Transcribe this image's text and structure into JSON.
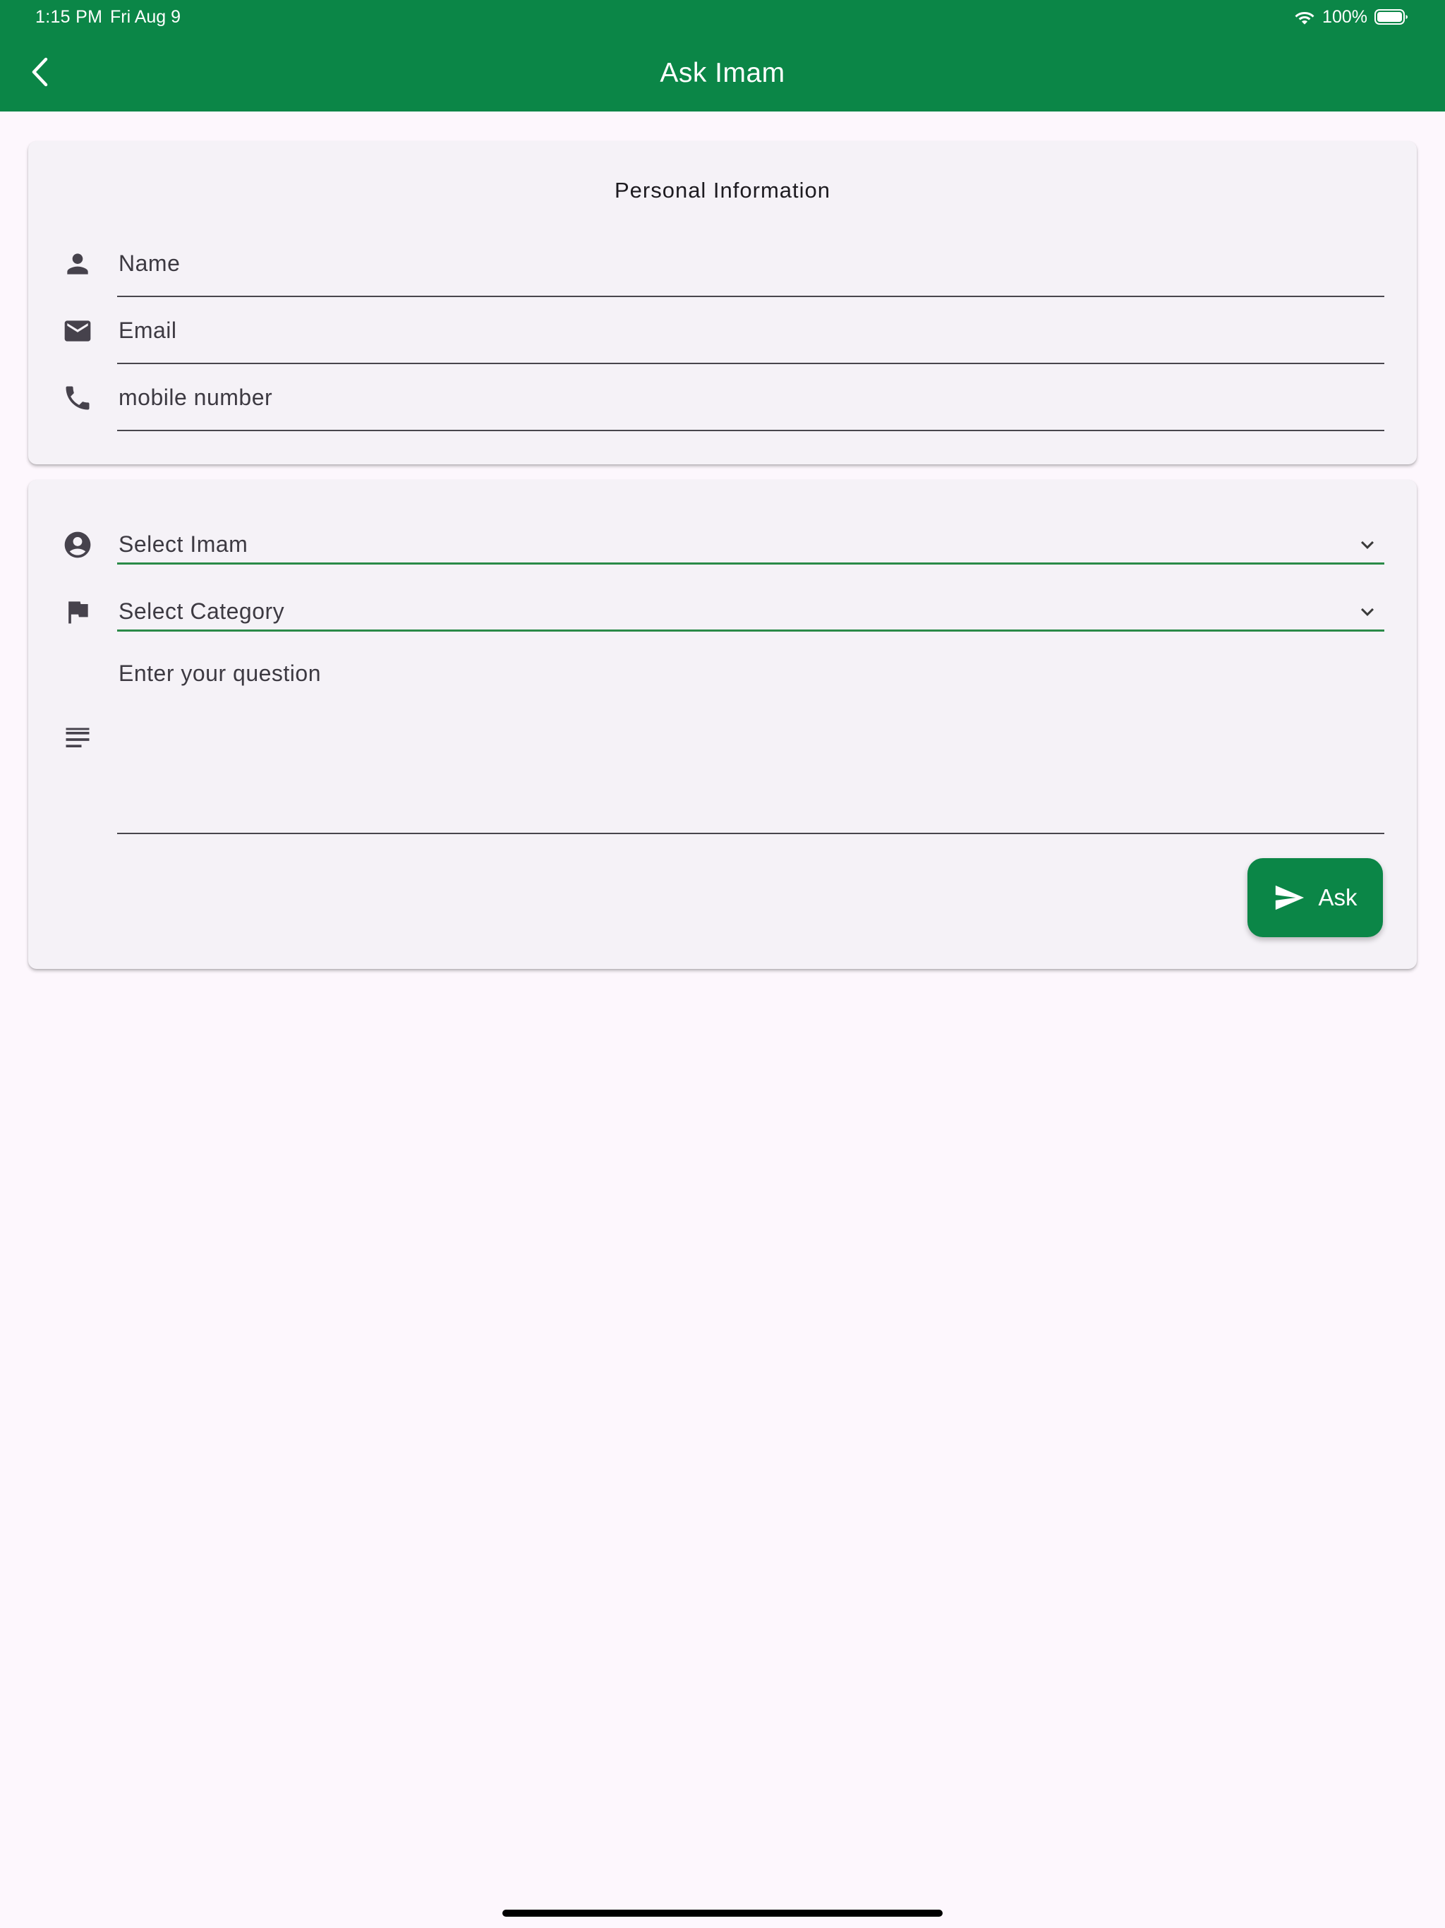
{
  "status_bar": {
    "time": "1:15 PM",
    "date": "Fri Aug 9",
    "battery": "100%"
  },
  "app_bar": {
    "title": "Ask Imam",
    "back_icon": "chevron-left-icon"
  },
  "personal_info": {
    "title": "Personal Information",
    "name_placeholder": "Name",
    "email_placeholder": "Email",
    "mobile_placeholder": "mobile number"
  },
  "question_form": {
    "imam_placeholder": "Select Imam",
    "category_placeholder": "Select Category",
    "question_label": "Enter your question",
    "ask_label": "Ask"
  },
  "colors": {
    "primary": "#0b8647",
    "background": "#fdf7fd",
    "card": "#f5f2f7"
  }
}
